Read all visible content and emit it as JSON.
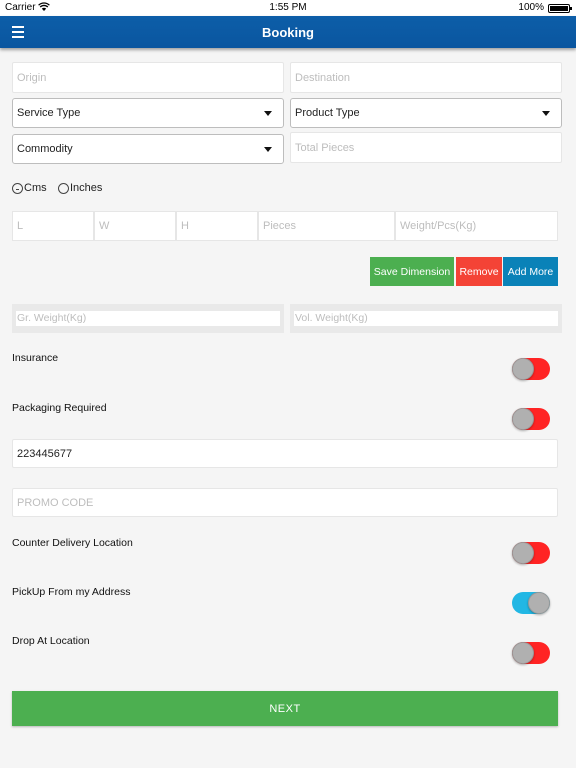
{
  "status": {
    "carrier": "Carrier",
    "time": "1:55 PM",
    "battery": "100%"
  },
  "header": {
    "title": "Booking",
    "menu_icon": "hamburger-menu-icon"
  },
  "form": {
    "origin_placeholder": "Origin",
    "destination_placeholder": "Destination",
    "service_type": "Service Type",
    "product_type": "Product Type",
    "commodity": "Commodity",
    "total_pieces_placeholder": "Total Pieces",
    "units": {
      "cms": "Cms",
      "inches": "Inches",
      "selected": "Cms"
    },
    "dimensions": {
      "l": "L",
      "w": "W",
      "h": "H",
      "pieces": "Pieces",
      "weight": "Weight/Pcs(Kg)"
    },
    "buttons": {
      "save": "Save Dimension",
      "remove": "Remove",
      "add_more": "Add More"
    },
    "gross_weight_placeholder": "Gr. Weight(Kg)",
    "vol_weight_placeholder": "Vol. Weight(Kg)",
    "insurance": {
      "label": "Insurance",
      "on": false
    },
    "packaging": {
      "label": "Packaging Required",
      "on": false
    },
    "phone_value": "223445677",
    "promo_placeholder": "PROMO CODE",
    "counter_delivery": {
      "label": "Counter Delivery Location",
      "on": false
    },
    "pickup": {
      "label": "PickUp From my Address",
      "on": true
    },
    "drop": {
      "label": "Drop At Location",
      "on": false
    },
    "next_label": "NEXT"
  },
  "colors": {
    "appbar": "#0a56a0",
    "save": "#4caf50",
    "remove": "#f44336",
    "add_more": "#0a82b8",
    "toggle_off": "#ff2424",
    "toggle_on": "#22b7e4",
    "next": "#4caf50"
  }
}
